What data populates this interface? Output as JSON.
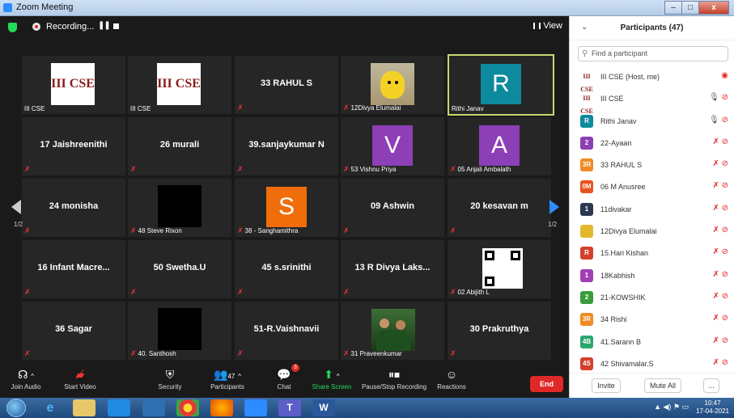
{
  "window": {
    "title": "Zoom Meeting",
    "minimize": "–",
    "maximize": "□",
    "close": "x"
  },
  "topbar": {
    "recording_label": "Recording...",
    "view_label": "View"
  },
  "tiles": [
    {
      "big": "",
      "label": "III CSE",
      "image_text": "III CSE"
    },
    {
      "big": "",
      "label": "III CSE",
      "image_text": "III CSE"
    },
    {
      "big": "33 RAHUL S",
      "label": ""
    },
    {
      "big": "",
      "label": "12Divya Elumalai"
    },
    {
      "big": "",
      "label": "Rithi Janav",
      "avatar": "R"
    },
    {
      "big": "17 Jaishreenithi",
      "label": ""
    },
    {
      "big": "26 murali",
      "label": ""
    },
    {
      "big": "39.sanjaykumar N",
      "label": ""
    },
    {
      "big": "",
      "label": "53 Vishnu Priya",
      "avatar": "V"
    },
    {
      "big": "",
      "label": "05 Anjali Ambalath",
      "avatar": "A"
    },
    {
      "big": "24 monisha",
      "label": ""
    },
    {
      "big": "",
      "label": "48 Steve Rixon"
    },
    {
      "big": "",
      "label": "38 - Sanghamithra",
      "avatar": "S"
    },
    {
      "big": "09 Ashwin",
      "label": ""
    },
    {
      "big": "20 kesavan m",
      "label": ""
    },
    {
      "big": "16 Infant Macre...",
      "label": ""
    },
    {
      "big": "50 Swetha.U",
      "label": ""
    },
    {
      "big": "45 s.srinithi",
      "label": ""
    },
    {
      "big": "13 R Divya Laks...",
      "label": ""
    },
    {
      "big": "",
      "label": "02 Abijith L"
    },
    {
      "big": "36 Sagar",
      "label": ""
    },
    {
      "big": "",
      "label": "40. Santhosh"
    },
    {
      "big": "51-R.Vaishnavii",
      "label": ""
    },
    {
      "big": "",
      "label": "31 Praveenkumar"
    },
    {
      "big": "30 Prakruthya",
      "label": ""
    }
  ],
  "pages": {
    "left": "1/2",
    "right": "1/2"
  },
  "toolbar": {
    "join_audio": "Join Audio",
    "start_video": "Start Video",
    "security": "Security",
    "participants": "Participants",
    "participants_count": "47",
    "chat": "Chat",
    "chat_badge": "3",
    "share_screen": "Share Screen",
    "pause_recording": "Pause/Stop Recording",
    "reactions": "Reactions",
    "end": "End"
  },
  "panel": {
    "title": "Participants (47)",
    "search_placeholder": "Find a participant",
    "participants": [
      {
        "avatar": "III CSE",
        "name": "III CSE (Host, me)",
        "color": ""
      },
      {
        "avatar": "III CSE",
        "name": "III CSE",
        "color": ""
      },
      {
        "avatar": "R",
        "name": "Rithi Janav",
        "color": "#0e8a9e"
      },
      {
        "avatar": "2",
        "name": "22-Ayaan",
        "color": "#8d3fb6"
      },
      {
        "avatar": "3R",
        "name": "33 RAHUL S",
        "color": "#f08a24"
      },
      {
        "avatar": "0M",
        "name": "06 M Anusree",
        "color": "#e8531e"
      },
      {
        "avatar": "1",
        "name": "11divakar",
        "color": "#2b3a52"
      },
      {
        "avatar": "",
        "name": "12Divya Elumalai",
        "color": "#e2b92d"
      },
      {
        "avatar": "R",
        "name": "15.Hari Kishan",
        "color": "#d4402b"
      },
      {
        "avatar": "1",
        "name": "18Kabhish",
        "color": "#a23fb5"
      },
      {
        "avatar": "2",
        "name": "21-KOWSHIK",
        "color": "#3a9d3a"
      },
      {
        "avatar": "3R",
        "name": "34 Rishi",
        "color": "#f08a24"
      },
      {
        "avatar": "4B",
        "name": "41.Sarann B",
        "color": "#2aa76d"
      },
      {
        "avatar": "4S",
        "name": "42 Shivamalar.S",
        "color": "#d4402b"
      }
    ],
    "invite": "Invite",
    "mute_all": "Mute All",
    "more": "..."
  },
  "taskbar": {
    "time": "10:47",
    "date": "17-04-2021"
  }
}
